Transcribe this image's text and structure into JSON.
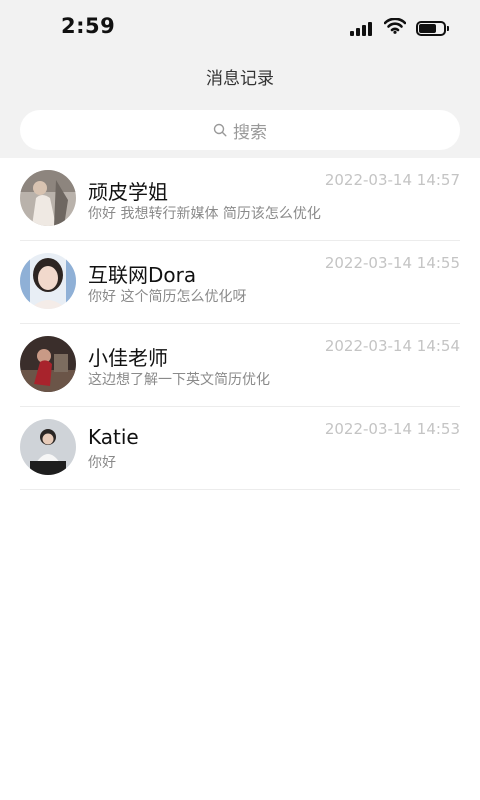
{
  "status_bar": {
    "time": "2:59",
    "icons": [
      "signal-icon",
      "wifi-icon",
      "battery-icon"
    ]
  },
  "header": {
    "title": "消息记录"
  },
  "search": {
    "icon": "search-icon",
    "placeholder": "搜索"
  },
  "messages": [
    {
      "name": "顽皮学姐",
      "preview": "你好 我想转行新媒体 简历该怎么优化",
      "time": "2022-03-14 14:57"
    },
    {
      "name": "互联网Dora",
      "preview": "你好 这个简历怎么优化呀",
      "time": "2022-03-14 14:55"
    },
    {
      "name": "小佳老师",
      "preview": "这边想了解一下英文简历优化",
      "time": "2022-03-14 14:54"
    },
    {
      "name": "Katie",
      "preview": "你好",
      "time": "2022-03-14 14:53"
    }
  ],
  "colors": {
    "header_bg": "#f2f2f2",
    "timestamp": "#c4c4c4",
    "preview_text": "#8a8a8a"
  }
}
